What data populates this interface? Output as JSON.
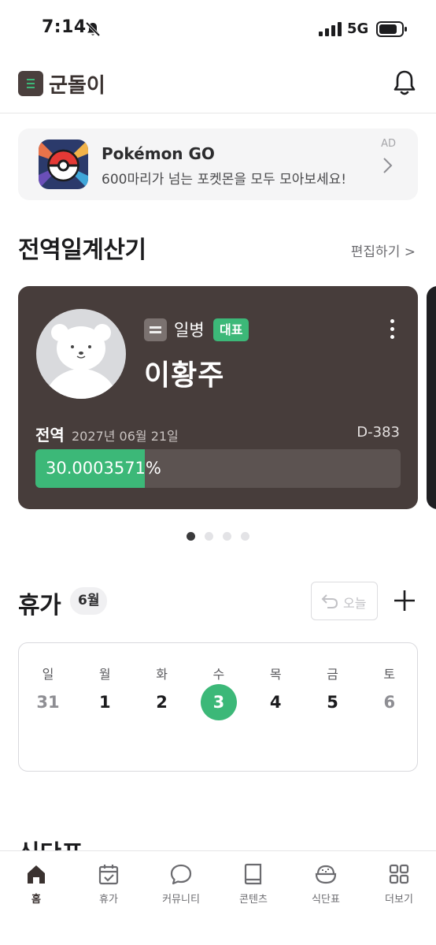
{
  "status_bar": {
    "time": "7:14",
    "network": "5G"
  },
  "header": {
    "app_title": "군돌이"
  },
  "ad": {
    "title": "Pokémon GO",
    "description": "600마리가 넘는 포켓몬을 모두 모아보세요!",
    "tag": "AD"
  },
  "service_section": {
    "title": "전역일계산기",
    "edit_label": "편집하기 >"
  },
  "service_card": {
    "rank": "일병",
    "badge": "대표",
    "name": "이황주",
    "discharge_label": "전역",
    "discharge_date": "2027년 06월 21일",
    "dday": "D-383",
    "progress_text": "30.0003571%",
    "progress_value": 30.0003571
  },
  "carousel": {
    "pages": 4,
    "active": 0
  },
  "vacation": {
    "title": "휴가",
    "month": "6월",
    "today_label": "오늘",
    "weekdays": [
      "일",
      "월",
      "화",
      "수",
      "목",
      "금",
      "토"
    ],
    "days": [
      {
        "label": "31",
        "state": "muted"
      },
      {
        "label": "1",
        "state": "normal"
      },
      {
        "label": "2",
        "state": "normal"
      },
      {
        "label": "3",
        "state": "today"
      },
      {
        "label": "4",
        "state": "normal"
      },
      {
        "label": "5",
        "state": "normal"
      },
      {
        "label": "6",
        "state": "muted"
      }
    ]
  },
  "meal_section": {
    "title": "식단표"
  },
  "tab_bar": {
    "items": [
      {
        "label": "홈",
        "icon": "home-icon",
        "active": true
      },
      {
        "label": "휴가",
        "icon": "calendar-check-icon",
        "active": false
      },
      {
        "label": "커뮤니티",
        "icon": "chat-bubble-icon",
        "active": false
      },
      {
        "label": "콘텐츠",
        "icon": "book-icon",
        "active": false
      },
      {
        "label": "식단표",
        "icon": "rice-bowl-icon",
        "active": false
      },
      {
        "label": "더보기",
        "icon": "grid-icon",
        "active": false
      }
    ]
  },
  "colors": {
    "accent": "#3cb878",
    "card": "#473d3b",
    "brand_dark": "#4a3f3d"
  }
}
